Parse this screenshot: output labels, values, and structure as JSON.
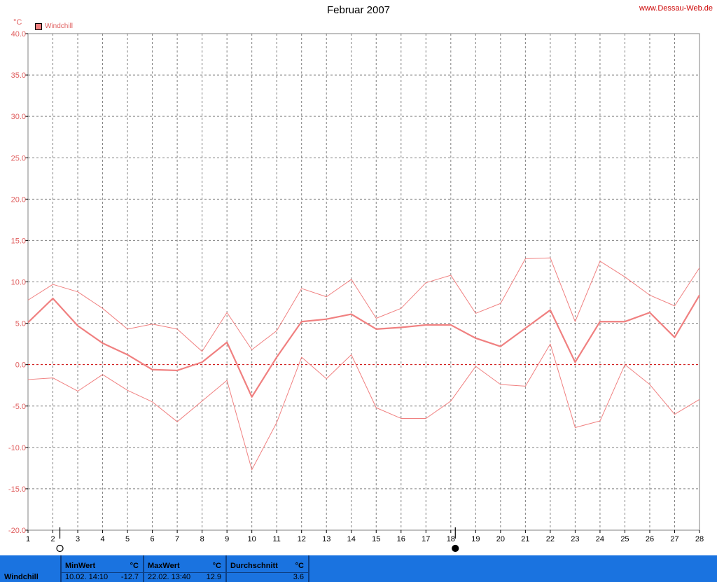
{
  "title": "Februar 2007",
  "source": "www.Dessau-Web.de",
  "unit": "°C",
  "colors": {
    "series": "#f08080",
    "zero_line": "#cc0000",
    "grid": "#808080",
    "axis_text": "#e06060",
    "footer": "#1a73e0"
  },
  "chart_data": {
    "type": "line",
    "title": "Februar 2007",
    "ylabel": "°C",
    "ylim": [
      -20,
      40
    ],
    "ytick_labels": [
      "40.0",
      "35.0",
      "30.0",
      "25.0",
      "20.0",
      "15.0",
      "10.0",
      "5.0",
      "0.0",
      "-5.0",
      "-10.0",
      "-15.0",
      "-20.0"
    ],
    "ytick_values": [
      40,
      35,
      30,
      25,
      20,
      15,
      10,
      5,
      0,
      -5,
      -10,
      -15,
      -20
    ],
    "x": [
      1,
      2,
      3,
      4,
      5,
      6,
      7,
      8,
      9,
      10,
      11,
      12,
      13,
      14,
      15,
      16,
      17,
      18,
      19,
      20,
      21,
      22,
      23,
      24,
      25,
      26,
      27,
      28
    ],
    "grid": true,
    "legend": [
      {
        "name": "Windchill",
        "position": "top-left"
      }
    ],
    "moon_phases": [
      {
        "day": 2,
        "phase": "full-moon"
      },
      {
        "day": 17.9,
        "phase": "new-moon"
      }
    ],
    "series": [
      {
        "name": "Windchill",
        "role": "average",
        "values": [
          5.1,
          8.0,
          4.7,
          2.6,
          1.2,
          -0.6,
          -0.7,
          0.3,
          2.7,
          -3.9,
          0.9,
          5.2,
          5.5,
          6.1,
          4.3,
          4.5,
          4.8,
          4.8,
          3.2,
          2.2,
          4.4,
          6.6,
          0.3,
          5.2,
          5.2,
          6.3,
          3.3,
          8.4
        ]
      },
      {
        "role": "max",
        "values": [
          7.8,
          9.7,
          8.8,
          6.8,
          4.3,
          4.9,
          4.3,
          1.6,
          6.3,
          1.8,
          4.1,
          9.2,
          8.2,
          10.3,
          5.6,
          6.8,
          9.9,
          10.8,
          6.2,
          7.4,
          12.8,
          12.9,
          5.2,
          12.5,
          10.6,
          8.4,
          7.1,
          11.7
        ]
      },
      {
        "role": "min",
        "values": [
          -1.8,
          -1.6,
          -3.2,
          -1.2,
          -3.1,
          -4.5,
          -6.9,
          -4.4,
          -1.9,
          -12.7,
          -7.0,
          0.9,
          -1.7,
          1.2,
          -5.2,
          -6.5,
          -6.5,
          -4.4,
          -0.2,
          -2.4,
          -2.6,
          2.5,
          -7.6,
          -6.8,
          0.0,
          -2.4,
          -6.0,
          -4.2
        ]
      }
    ]
  },
  "footer": {
    "label": "Windchill",
    "min": {
      "header": "MinWert",
      "unit": "°C",
      "datetime": "10.02.  14:10",
      "value": "-12.7"
    },
    "max": {
      "header": "MaxWert",
      "unit": "°C",
      "datetime": "22.02.  13:40",
      "value": "12.9"
    },
    "avg": {
      "header": "Durchschnitt",
      "unit": "°C",
      "value": "3.6"
    }
  }
}
